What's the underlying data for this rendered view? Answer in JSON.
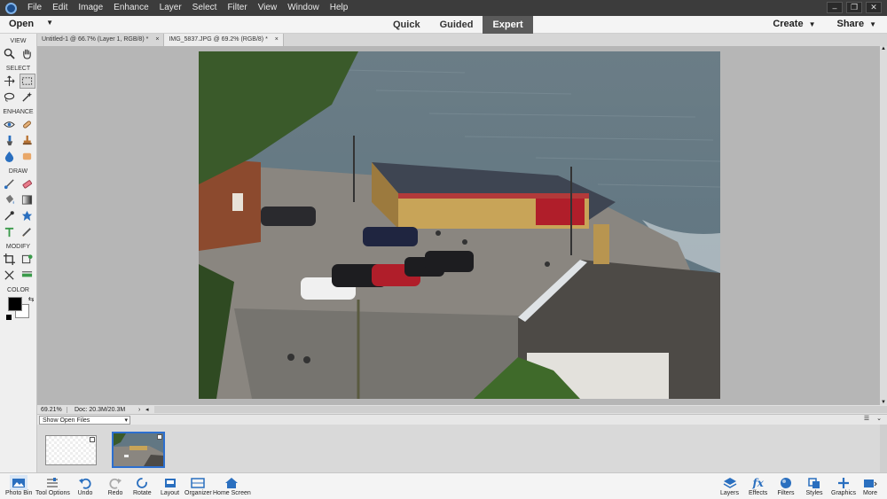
{
  "menubar": {
    "items": [
      "File",
      "Edit",
      "Image",
      "Enhance",
      "Layer",
      "Select",
      "Filter",
      "View",
      "Window",
      "Help"
    ]
  },
  "modebar": {
    "open_label": "Open",
    "modes": [
      "Quick",
      "Guided",
      "Expert"
    ],
    "active_mode": "Expert",
    "create_label": "Create",
    "share_label": "Share"
  },
  "toolpanel": {
    "sections": {
      "view": "VIEW",
      "select": "SELECT",
      "enhance": "ENHANCE",
      "draw": "DRAW",
      "modify": "MODIFY",
      "color": "COLOR"
    },
    "foreground_color": "#000000",
    "background_color": "#ffffff"
  },
  "doc_tabs": [
    {
      "title": "Untitled-1 @ 66.7% (Layer 1, RGB/8) *",
      "close": "×"
    },
    {
      "title": "IMG_5837.JPG @ 69.2% (RGB/8) *",
      "close": "×"
    }
  ],
  "status": {
    "zoom": "69.21%",
    "doc_size": "Doc: 20.3M/20.3M"
  },
  "photobin": {
    "show_label": "Show Open Files"
  },
  "taskbar": {
    "left": [
      "Photo Bin",
      "Tool Options",
      "Undo",
      "Redo",
      "Rotate",
      "Layout",
      "Organizer",
      "Home Screen"
    ],
    "right": [
      "Layers",
      "Effects",
      "Filters",
      "Styles",
      "Graphics",
      "More"
    ]
  },
  "colors": {
    "menubar": "#3c3c3c",
    "active_mode": "#5a5a5a",
    "accent": "#2c6fd0"
  }
}
